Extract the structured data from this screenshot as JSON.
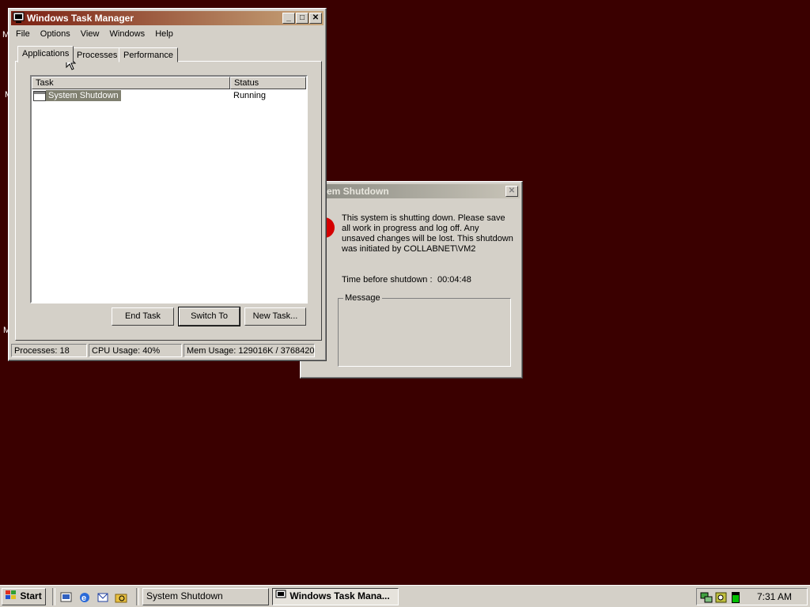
{
  "desktop": {
    "background": "#3a0000",
    "icon_fragments": [
      "M",
      "M",
      "M"
    ]
  },
  "task_manager": {
    "title": "Windows Task Manager",
    "menu": [
      "File",
      "Options",
      "View",
      "Windows",
      "Help"
    ],
    "tabs": [
      "Applications",
      "Processes",
      "Performance"
    ],
    "active_tab": "Applications",
    "columns": [
      "Task",
      "Status"
    ],
    "rows": [
      {
        "task": "System Shutdown",
        "status": "Running"
      }
    ],
    "buttons": {
      "end_task": "End Task",
      "switch_to": "Switch To",
      "new_task": "New Task..."
    },
    "status": {
      "processes": "Processes: 18",
      "cpu": "CPU Usage: 40%",
      "mem": "Mem Usage: 129016K / 3768420K"
    }
  },
  "shutdown_dialog": {
    "title": "System Shutdown",
    "title_visible": "em Shutdown",
    "message": "This system is shutting down. Please save all work in progress and log off. Any unsaved changes will be lost. This shutdown was initiated by COLLABNET\\VM2",
    "time_label": "Time before shutdown :",
    "time_value": "00:04:48",
    "message_group_label": "Message"
  },
  "taskbar": {
    "start_label": "Start",
    "quicklaunch_icons": [
      "show-desktop-icon",
      "ie-icon",
      "outlook-icon",
      "explorer-icon"
    ],
    "buttons": [
      {
        "label": "System Shutdown",
        "pressed": false
      },
      {
        "label": "Windows Task Mana...",
        "pressed": true
      }
    ],
    "tray_icons": [
      "network-icon",
      "volume-icon",
      "cpu-meter-icon"
    ],
    "clock": "7:31 AM"
  },
  "colors": {
    "title_active_left": "#7a1f12",
    "title_active_right": "#c8a67a",
    "face": "#d4d0c8",
    "selection": "#808070"
  }
}
